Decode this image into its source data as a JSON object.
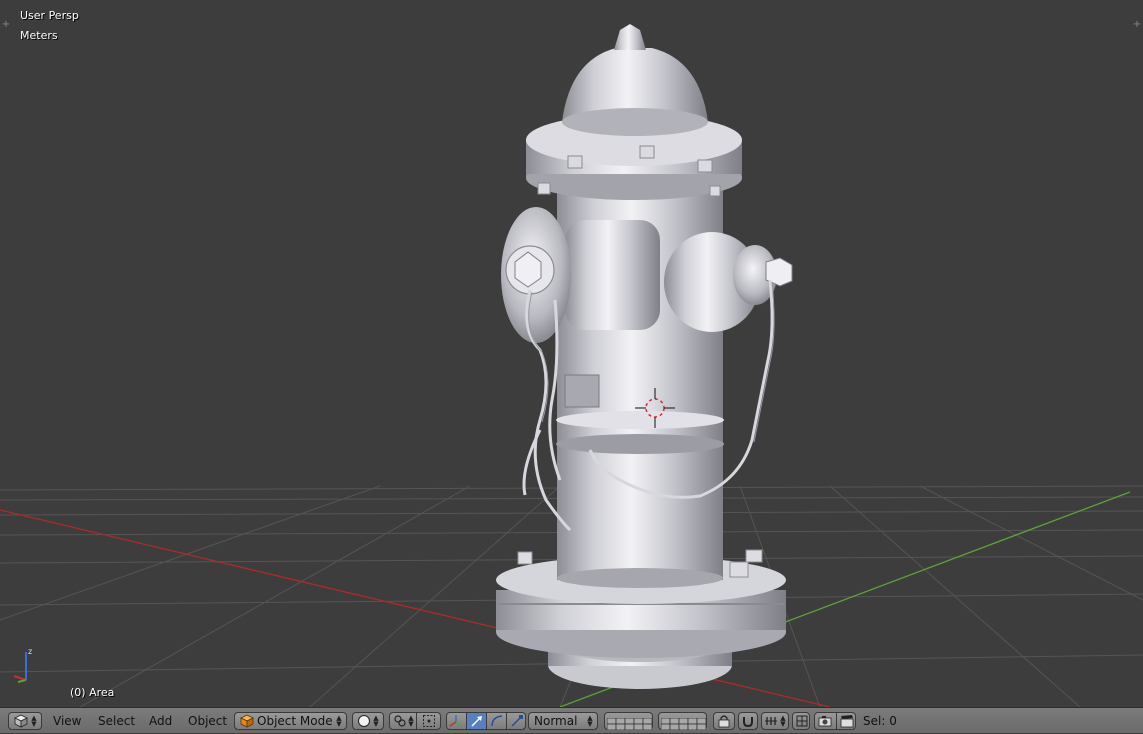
{
  "viewport": {
    "view_name": "User Persp",
    "units": "Meters",
    "object_info": "(0) Area"
  },
  "header": {
    "editor_type_icon": "cube-icon",
    "menus": [
      "View",
      "Select",
      "Add",
      "Object"
    ],
    "mode": "Object Mode",
    "mode_icon": "orange-cube-icon",
    "viewport_shading_icon": "sphere-shading-icon",
    "pivot_icon": "pivot-point-icon",
    "manipulator_icons": [
      "manipulator-axes-icon",
      "translate-arrow-icon",
      "rotate-arc-icon",
      "scale-icon"
    ],
    "orientation": "Normal",
    "layers_icon": "layer-grid-icon",
    "snap_icon": "snap-magnet-icon",
    "render_icons": [
      "camera-icon",
      "clapper-icon"
    ],
    "selection_count": "Sel: 0"
  },
  "colors": {
    "viewport_bg": "#3d3d3d",
    "grid_line": "#555555",
    "x_axis": "#b02a2a",
    "y_axis": "#5da13a",
    "header_bg": "#737373",
    "active_button": "#5680c2"
  }
}
